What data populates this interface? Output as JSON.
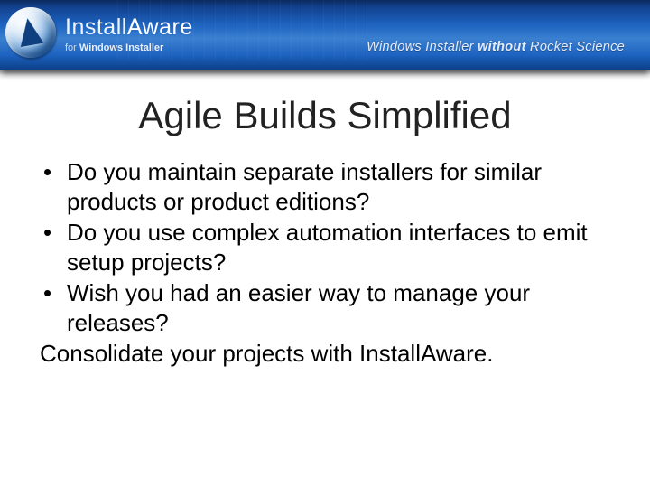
{
  "header": {
    "brand_install": "Install",
    "brand_aware": "Aware",
    "brand_sub_for": "for ",
    "brand_sub_wi": "Windows Installer",
    "tagline_prefix": "Windows Installer ",
    "tagline_italic": "without",
    "tagline_suffix": " Rocket Science"
  },
  "title": "Agile Builds Simplified",
  "bullets": [
    "Do you maintain separate installers for similar products or product editions?",
    "Do you use complex automation interfaces to emit setup projects?",
    "Wish you had an easier way to manage your releases?"
  ],
  "closing": "Consolidate your projects with InstallAware."
}
